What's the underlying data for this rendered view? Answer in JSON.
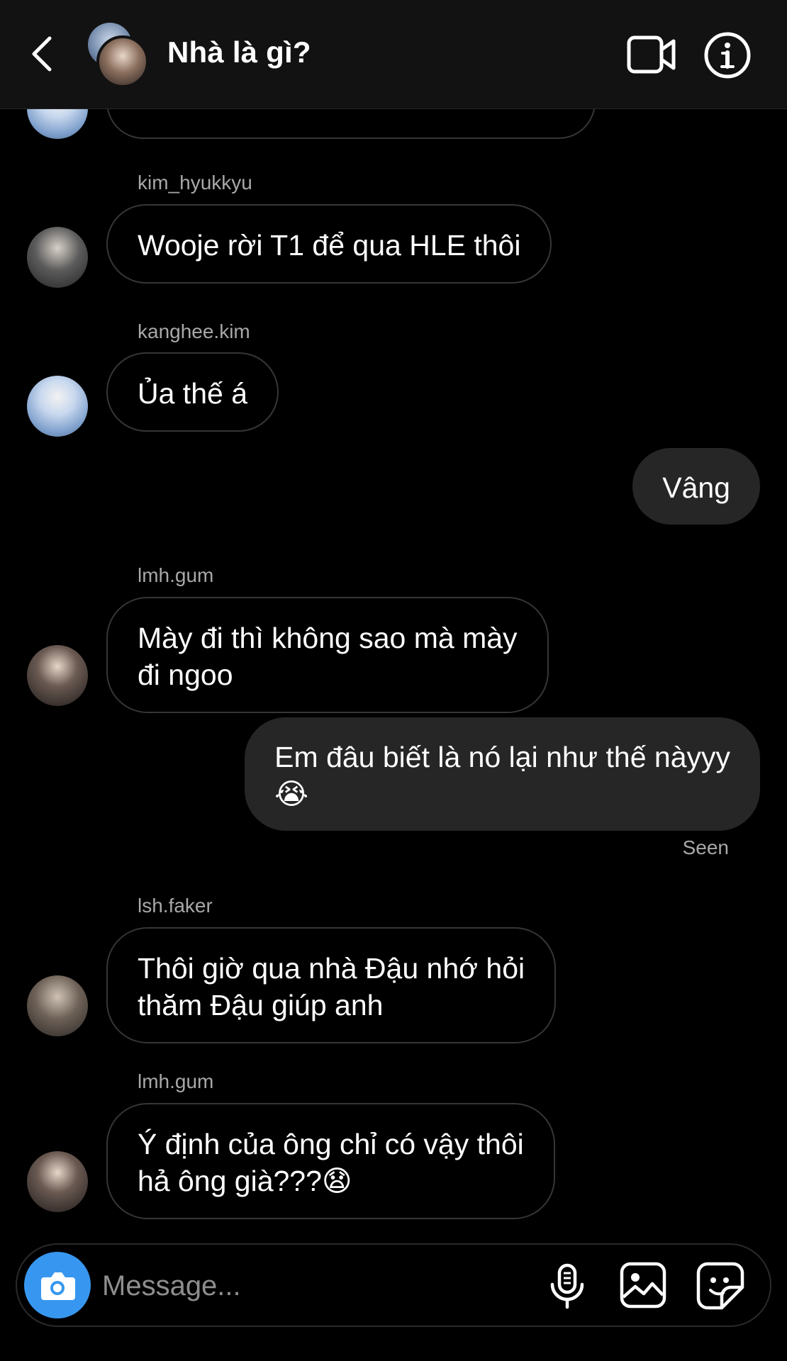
{
  "header": {
    "title": "Nhà là gì?",
    "back_icon": "chevron-left-icon",
    "video_icon": "video-camera-icon",
    "info_icon": "info-icon"
  },
  "messages": [
    {
      "sender": "kim_hyukkyu",
      "text": "Wooje rời T1 để qua HLE thôi",
      "direction": "incoming"
    },
    {
      "sender": "kanghee.kim",
      "text": "Ủa thế á",
      "direction": "incoming"
    },
    {
      "sender": "",
      "text": "Vâng",
      "direction": "outgoing"
    },
    {
      "sender": "lmh.gum",
      "text": "Mày đi thì không sao mà mày\nđi ngoo",
      "direction": "incoming"
    },
    {
      "sender": "",
      "text": "Em đâu biết là nó lại như thế nàyyy\n😭",
      "direction": "outgoing"
    },
    {
      "sender": "lsh.faker",
      "text": "Thôi giờ qua nhà Đậu nhớ hỏi\nthăm Đậu giúp anh",
      "direction": "incoming"
    },
    {
      "sender": "lmh.gum",
      "text": "Ý định của ông chỉ có vậy thôi\nhả ông già???😧",
      "direction": "incoming"
    }
  ],
  "status": {
    "seen": "Seen"
  },
  "composer": {
    "placeholder": "Message...",
    "value": "",
    "icons": [
      "camera-icon",
      "microphone-icon",
      "gallery-icon",
      "sticker-icon"
    ]
  },
  "colors": {
    "background": "#000000",
    "header_bg": "#121212",
    "outgoing_bubble": "#262626",
    "incoming_border": "#363636",
    "camera_button": "#3797f0",
    "muted_text": "#a8a8a8"
  }
}
